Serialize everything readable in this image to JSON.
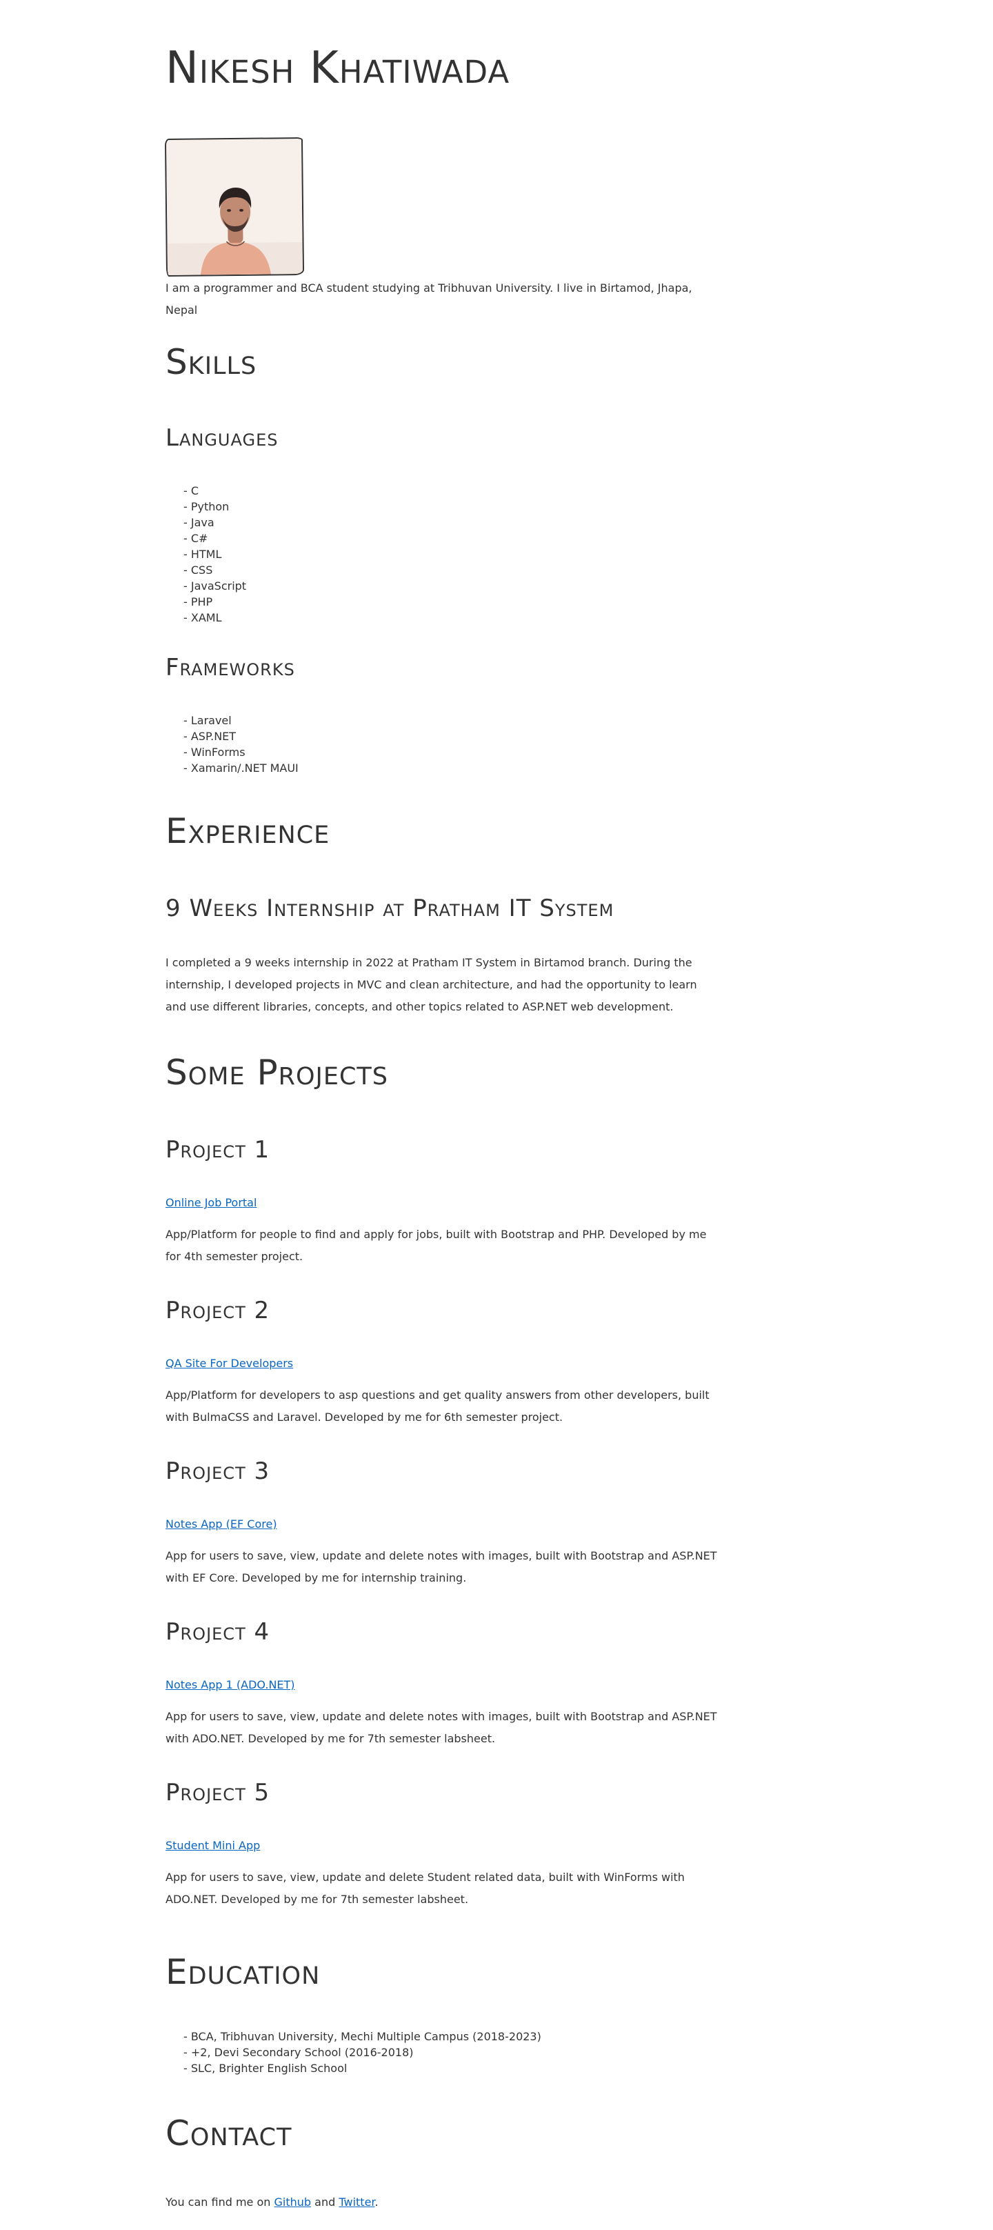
{
  "header": {
    "name": "Nikesh Khatiwada",
    "intro": "I am a programmer and BCA student studying at Tribhuvan University. I live in Birtamod, Jhapa, Nepal"
  },
  "skills": {
    "title": "Skills",
    "languages_title": "Languages",
    "languages": [
      "C",
      "Python",
      "Java",
      "C#",
      "HTML",
      "CSS",
      "JavaScript",
      "PHP",
      "XAML"
    ],
    "frameworks_title": "Frameworks",
    "frameworks": [
      "Laravel",
      "ASP.NET",
      "WinForms",
      "Xamarin/.NET MAUI"
    ]
  },
  "experience": {
    "title": "Experience",
    "job_title": "9 Weeks Internship at Pratham IT System",
    "description": "I completed a 9 weeks internship in 2022 at Pratham IT System in Birtamod branch. During the internship, I developed projects in MVC and clean architecture, and had the opportunity to learn and use different libraries, concepts, and other topics related to ASP.NET web development."
  },
  "projects": {
    "title": "Some Projects",
    "items": [
      {
        "heading": "Project 1",
        "link": "Online Job Portal",
        "description": "App/Platform for people to find and apply for jobs, built with Bootstrap and PHP. Developed by me for 4th semester project."
      },
      {
        "heading": "Project 2",
        "link": "QA Site For Developers",
        "description": "App/Platform for developers to asp questions and get quality answers from other developers, built with BulmaCSS and Laravel. Developed by me for 6th semester project."
      },
      {
        "heading": "Project 3",
        "link": "Notes App (EF Core)",
        "description": "App for users to save, view, update and delete notes with images, built with Bootstrap and ASP.NET with EF Core. Developed by me for internship training."
      },
      {
        "heading": "Project 4",
        "link": "Notes App 1 (ADO.NET)",
        "description": "App for users to save, view, update and delete notes with images, built with Bootstrap and ASP.NET with ADO.NET. Developed by me for 7th semester labsheet."
      },
      {
        "heading": "Project 5",
        "link": "Student Mini App",
        "description": "App for users to save, view, update and delete Student related data, built with WinForms with ADO.NET. Developed by me for 7th semester labsheet."
      }
    ]
  },
  "education": {
    "title": "Education",
    "items": [
      "BCA, Tribhuvan University, Mechi Multiple Campus (2018-2023)",
      "+2, Devi Secondary School (2016-2018)",
      "SLC, Brighter English School"
    ]
  },
  "contact": {
    "title": "Contact",
    "prefix": "You can find me on",
    "github": "Github",
    "and": "and",
    "twitter": "Twitter",
    "suffix": "."
  },
  "colors": {
    "text": "#333333",
    "link": "#0a66c2",
    "background": "#ffffff"
  }
}
